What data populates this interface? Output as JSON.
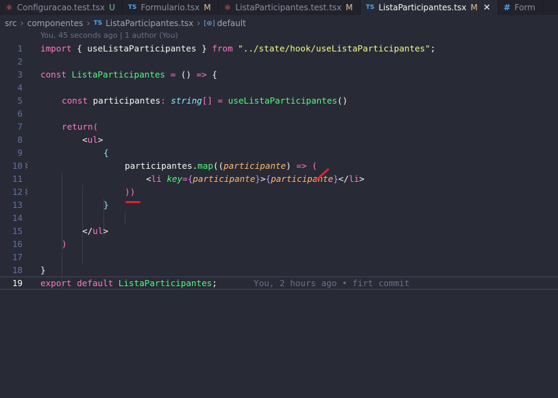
{
  "tabs": [
    {
      "icon": "react-icon",
      "label": "Configuracao.test.tsx",
      "status": "U"
    },
    {
      "icon": "typescript-icon",
      "label": "Formulario.tsx",
      "status": "M"
    },
    {
      "icon": "react-icon",
      "label": "ListaParticipantes.test.tsx",
      "status": "M"
    },
    {
      "icon": "typescript-icon",
      "label": "ListaParticipantes.tsx",
      "status": "M",
      "active": true
    },
    {
      "icon": "css-icon",
      "label": "Form",
      "status": ""
    }
  ],
  "icons": {
    "typescript": "TS",
    "react": "⚛",
    "css": "#",
    "close": "✕",
    "chevron": "›",
    "symbol": "[⊛]"
  },
  "breadcrumb": {
    "src": "src",
    "folder": "componentes",
    "file": "ListaParticipantes.tsx",
    "symbol": "default"
  },
  "blame": "You, 45 seconds ago | 1 author (You)",
  "line_numbers": [
    "1",
    "2",
    "3",
    "4",
    "5",
    "6",
    "7",
    "8",
    "9",
    "10",
    "11",
    "12",
    "13",
    "14",
    "15",
    "16",
    "17",
    "18",
    "19"
  ],
  "code": {
    "l1": {
      "import": "import",
      "brace_open": " { ",
      "hook": "useListaParticipantes",
      "brace_close": " } ",
      "from": "from",
      "path": " \"../state/hook/useListaParticipantes\"",
      "semi": ";"
    },
    "l3": {
      "const": "const",
      "name": " ListaParticipantes",
      "eq": " = ",
      "params": "()",
      "arrow": " =>",
      "brace": " {"
    },
    "l5": {
      "const": "const",
      "var": " participantes",
      "colon": ": ",
      "type": "string",
      "bracket": "[]",
      "eq": " = ",
      "call": "useListaParticipantes",
      "parens": "()"
    },
    "l7": {
      "return": "return",
      "paren": "("
    },
    "l8": {
      "open": "<",
      "tag": "ul",
      "close": ">"
    },
    "l9": {
      "brace": "{"
    },
    "l10": {
      "obj": "participantes",
      "dot": ".",
      "method": "map",
      "p1": "((",
      "param": "participante",
      "p2": ")",
      "arrow": " =>",
      "p3": " ("
    },
    "l11": {
      "open": "<",
      "tag": "li",
      "attr": " key",
      "eq": "=",
      "b1": "{",
      "value": "participante",
      "b2": "}",
      "gt": ">",
      "b3": "{",
      "child": "participante",
      "b4": "}",
      "close_open": "</",
      "close_tag": "li",
      "close_gt": ">"
    },
    "l12": {
      "parens": "))"
    },
    "l13": {
      "brace": "}"
    },
    "l15": {
      "open": "</",
      "tag": "ul",
      "close": ">"
    },
    "l16": {
      "paren": ")"
    },
    "l18": {
      "brace": "}"
    },
    "l19": {
      "export": "export",
      "default": " default",
      "name": " ListaParticipantes",
      "semi": ";",
      "ghost": "You, 2 hours ago • firt commit"
    }
  },
  "colors": {
    "background": "#282a36",
    "keyword": "#ff79c6",
    "function": "#50fa7b",
    "string": "#f1fa8c",
    "parameter": "#ffb86c",
    "type": "#8be9fd",
    "annotation": "#e0202f"
  }
}
